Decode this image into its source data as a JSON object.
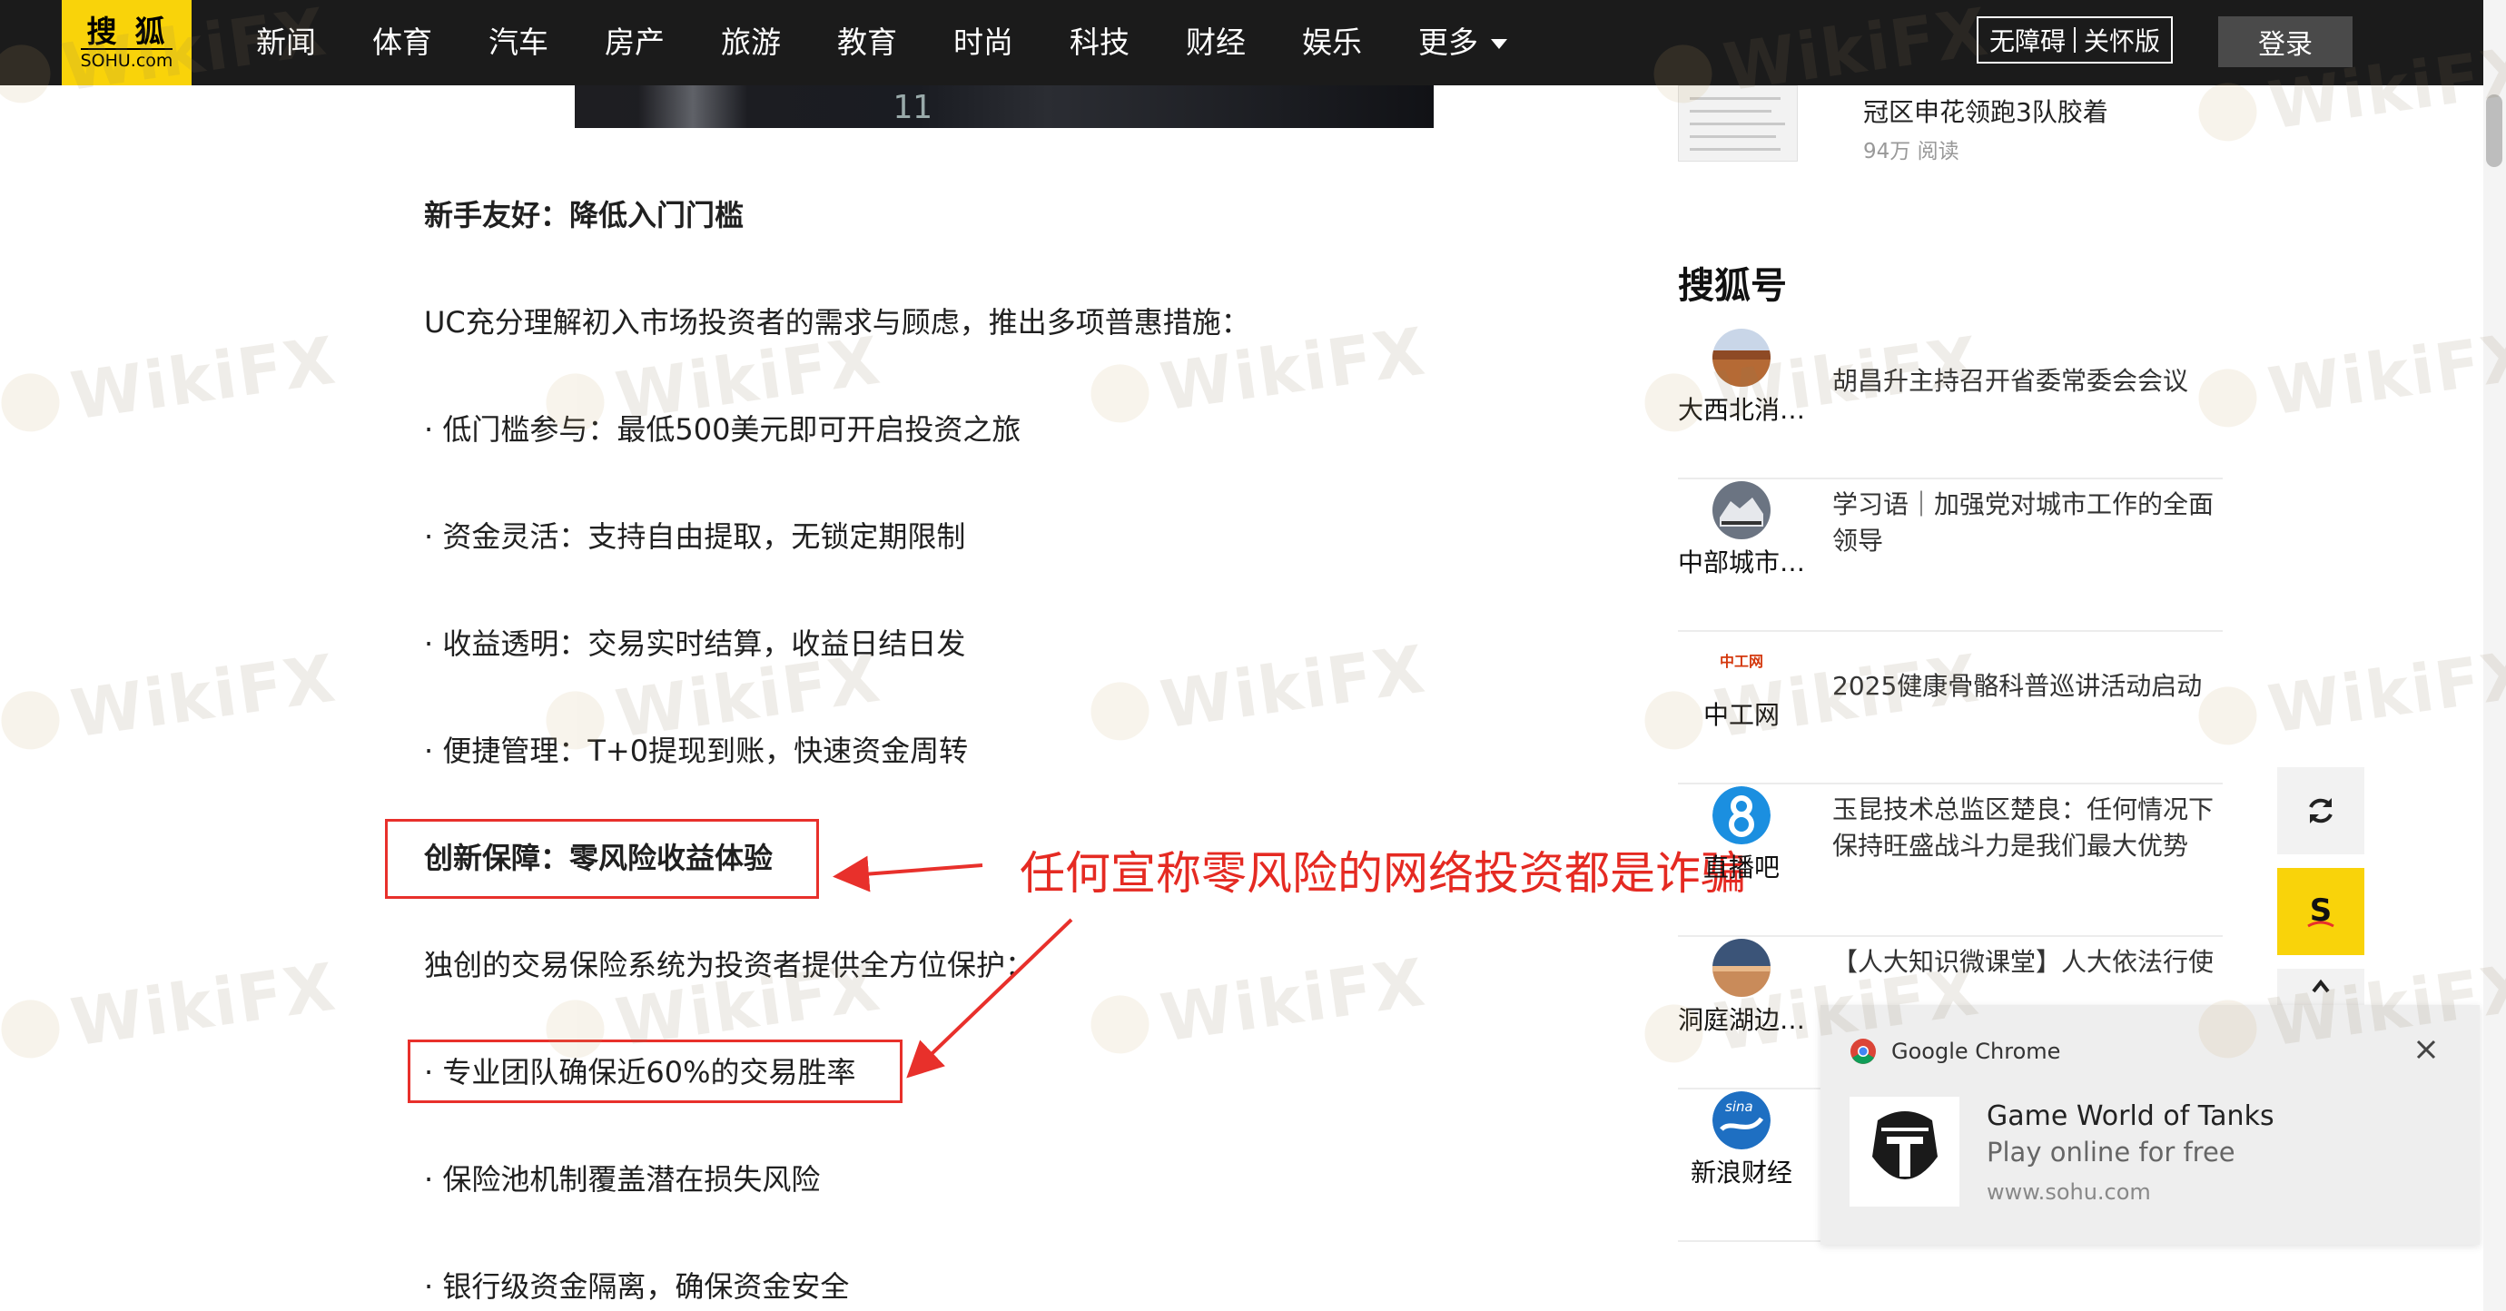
{
  "nav": {
    "logo_line1": "搜狐",
    "logo_line2": "SOHU.com",
    "items": [
      "新闻",
      "体育",
      "汽车",
      "房产",
      "旅游",
      "教育",
      "时尚",
      "科技",
      "财经",
      "娱乐"
    ],
    "more_label": "更多",
    "accessibility_label": "无障碍",
    "care_label": "关怀版",
    "login_label": "登录"
  },
  "article": {
    "image_text": "11",
    "paragraphs": [
      {
        "text": "新手友好：降低入门门槛",
        "bold": true
      },
      {
        "text": "UC充分理解初入市场投资者的需求与顾虑，推出多项普惠措施：",
        "bold": false
      },
      {
        "text": "· 低门槛参与：最低500美元即可开启投资之旅",
        "bold": false
      },
      {
        "text": "· 资金灵活：支持自由提取，无锁定期限制",
        "bold": false
      },
      {
        "text": "· 收益透明：交易实时结算，收益日结日发",
        "bold": false
      },
      {
        "text": "· 便捷管理：T+0提现到账，快速资金周转",
        "bold": false
      },
      {
        "text": "创新保障：零风险收益体验",
        "bold": true
      },
      {
        "text": "独创的交易保险系统为投资者提供全方位保护：",
        "bold": false
      },
      {
        "text": "· 专业团队确保近60%的交易胜率",
        "bold": false
      },
      {
        "text": "· 保险池机制覆盖潜在损失风险",
        "bold": false
      },
      {
        "text": "· 银行级资金隔离，确保资金安全",
        "bold": false
      }
    ]
  },
  "annotation": {
    "text": "任何宣称零风险的网络投资都是诈骗",
    "color": "#e52a22"
  },
  "sidebar": {
    "top_item": {
      "title": "冠区申花领跑3队胶着",
      "reads": "94万 阅读"
    },
    "section_title": "搜狐号",
    "accounts": [
      {
        "name": "大西北消…",
        "text": "胡昌升主持召开省委常委会会议"
      },
      {
        "name": "中部城市…",
        "text": "学习语｜加强党对城市工作的全面领导"
      },
      {
        "name": "中工网",
        "text": "2025健康骨骼科普巡讲活动启动",
        "logo_text": "中工网"
      },
      {
        "name": "直播吧",
        "text": "玉昆技术总监区楚良：任何情况下保持旺盛战斗力是我们最大优势"
      },
      {
        "name": "洞庭湖边…",
        "text": "【人大知识微课堂】人大依法行使任免权与工作形式解析"
      },
      {
        "name": "新浪财经",
        "text": "",
        "logo_text": "sina"
      }
    ]
  },
  "notification": {
    "app": "Google Chrome",
    "title": "Game World of Tanks",
    "body": "Play online for free",
    "site": "www.sohu.com"
  },
  "watermark": {
    "text": "WikiFX"
  },
  "colors": {
    "nav_bg": "#1b1b1b",
    "logo_bg": "#f9d30a",
    "annotation_red": "#e8302b",
    "sohu_yellow": "#f9d30a"
  }
}
